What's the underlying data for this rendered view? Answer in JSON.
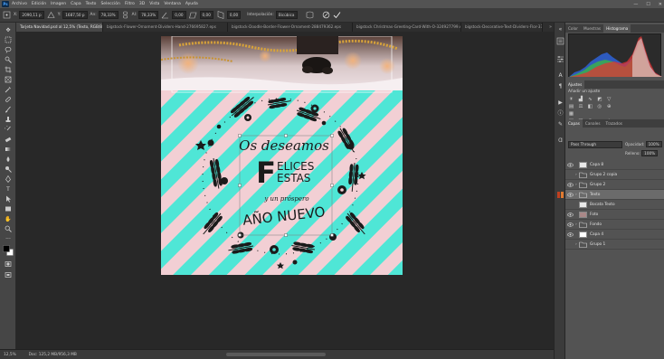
{
  "app": {
    "name": "Photoshop",
    "logo_text": "Ps"
  },
  "menu": [
    "Archivo",
    "Edición",
    "Imagen",
    "Capa",
    "Texto",
    "Selección",
    "Filtro",
    "3D",
    "Vista",
    "Ventana",
    "Ayuda"
  ],
  "window_controls": {
    "minimize": "—",
    "maximize": "☐",
    "close": "✕"
  },
  "options_bar": {
    "x_label": "X:",
    "x_value": "2090,11 p",
    "y_label": "Y:",
    "y_value": "1687,50 p",
    "w_label": "An:",
    "w_value": "78,33%",
    "h_label": "Al:",
    "h_value": "78,33%",
    "angle_value": "0,00",
    "skew_h": "0,00",
    "skew_v": "0,00",
    "interp_label": "Interpolación:",
    "interp_value": "Bicúbica"
  },
  "tabs": [
    {
      "label": "Tarjeta Navidad.psd al 12,5% (Texto, RGB/8) *",
      "active": true
    },
    {
      "label": "bigstock-Flower-Ornament-Dividers-Hand-276695827.eps",
      "active": false
    },
    {
      "label": "bigstock-Doodle-Border-Flower-Ornament-288479362.eps",
      "active": false
    },
    {
      "label": "bigstock Christmas-Greeting-Card-With-O-324927799.eps",
      "active": false
    },
    {
      "label": "bigstock-Decorative-Text-Dividers-Flor-331",
      "active": false
    }
  ],
  "status": {
    "zoom": "12,5%",
    "doc": "Doc: 125,2 MB/956,3 MB"
  },
  "artwork": {
    "line1": "Os deseamos",
    "line2a": "ELICES",
    "line2b": "ESTAS",
    "big_f": "F",
    "line3": "y un próspero",
    "line4": "AÑO NUEVO"
  },
  "panels": {
    "top_tabs": [
      "Color",
      "Muestras",
      "Histograma"
    ],
    "active_top": "Histograma",
    "adjust_title": "Ajustes",
    "adjust_hint": "Añadir un ajuste",
    "layer_tabs": [
      "Capas",
      "Canales",
      "Trazados"
    ],
    "blend": "Pass Through",
    "opacity_label": "Opacidad:",
    "opacity_value": "100%",
    "fill_label": "Relleno:",
    "fill_value": "100%",
    "layers": [
      {
        "name": "Capa 8",
        "type": "pixel",
        "visible": true,
        "selected": false
      },
      {
        "name": "Grupo 2 copia",
        "type": "group",
        "visible": false,
        "selected": false
      },
      {
        "name": "Grupo 2",
        "type": "group",
        "visible": true,
        "selected": false
      },
      {
        "name": "Texto",
        "type": "group",
        "visible": true,
        "selected": true
      },
      {
        "name": "Bocata Texto",
        "type": "pixel",
        "visible": false,
        "selected": false
      },
      {
        "name": "Foto",
        "type": "pixel",
        "visible": true,
        "selected": false
      },
      {
        "name": "Fondo",
        "type": "group",
        "visible": true,
        "selected": false
      },
      {
        "name": "Capa 4",
        "type": "pixel",
        "visible": true,
        "selected": false
      },
      {
        "name": "Grupo 1",
        "type": "group",
        "visible": false,
        "selected": false
      }
    ]
  },
  "colors": {
    "stripe_pink": "#f2cfd4",
    "stripe_cyan": "#4fe6d6",
    "wreath_ink": "#1b1b1b"
  }
}
